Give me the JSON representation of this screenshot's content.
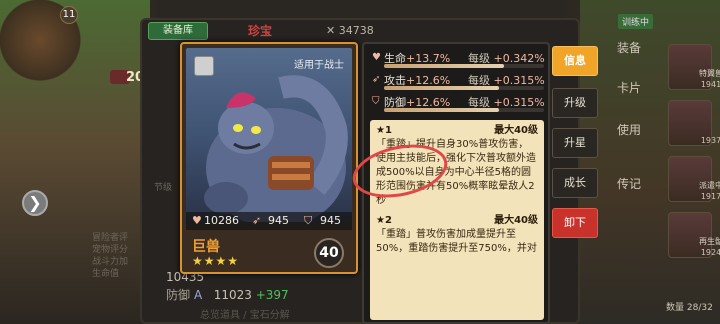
{
  "background": {
    "left_level": "11",
    "left_badge_number": "20",
    "back_tab": "装备库",
    "back_title": "珍宝",
    "back_count": "34738",
    "back_subtitle": "节级",
    "back_side_lines": [
      "冒险者评",
      "宠物评分",
      "战斗力加",
      "生命值"
    ],
    "back_stats": [
      {
        "label": "",
        "value": "10435",
        "plus": "",
        "rank": ""
      },
      {
        "label": "防御",
        "value": "11023",
        "plus": "+397",
        "rank": "A"
      }
    ],
    "back_footer": "总览道具 / 宝石分解"
  },
  "right_sidebar": {
    "top_tag": "训练中",
    "top_tag2": "训练中",
    "buttons": [
      "装备",
      "卡片",
      "使用",
      "传记"
    ],
    "cards": [
      {
        "name": "特翼兽",
        "num": "1941"
      },
      {
        "name": "",
        "num": "1937"
      },
      {
        "name": "",
        "num": ""
      },
      {
        "name": "派遣中",
        "num": "1917"
      },
      {
        "name": "再生骷",
        "num": "1924"
      },
      {
        "name": "",
        "num": ""
      }
    ],
    "sort": "数量 28/32"
  },
  "card": {
    "applies_to": "适用于战士",
    "hp": "10286",
    "atk": "945",
    "def": "945",
    "name": "巨兽",
    "stars": "★★★★",
    "level": "40"
  },
  "stats": [
    {
      "icon": "heart-icon",
      "name": "生命",
      "value": "+13.7%",
      "per_label": "每级",
      "per_value": "+0.342%",
      "fill": 0.75
    },
    {
      "icon": "sword-icon",
      "name": "攻击",
      "value": "+12.6%",
      "per_label": "每级",
      "per_value": "+0.315%",
      "fill": 0.72
    },
    {
      "icon": "shield-icon",
      "name": "防御",
      "value": "+12.6%",
      "per_label": "每级",
      "per_value": "+0.315%",
      "fill": 0.72
    }
  ],
  "skills": [
    {
      "star": "★1",
      "max": "最大40级",
      "text": "「重踏」提升自身30%普攻伤害，使用主技能后，强化下次普攻额外造成500%以自身为中心半径5格的圆形范围伤害并有50%概率眩晕敌人2秒"
    },
    {
      "star": "★2",
      "max": "最大40级",
      "text": "「重踏」普攻伤害加成量提升至50%，重踏伤害提升至750%，并对"
    }
  ],
  "tabs": {
    "info": "信息",
    "upgrade": "升级",
    "star_up": "升星",
    "growth": "成长",
    "unequip": "卸下"
  }
}
